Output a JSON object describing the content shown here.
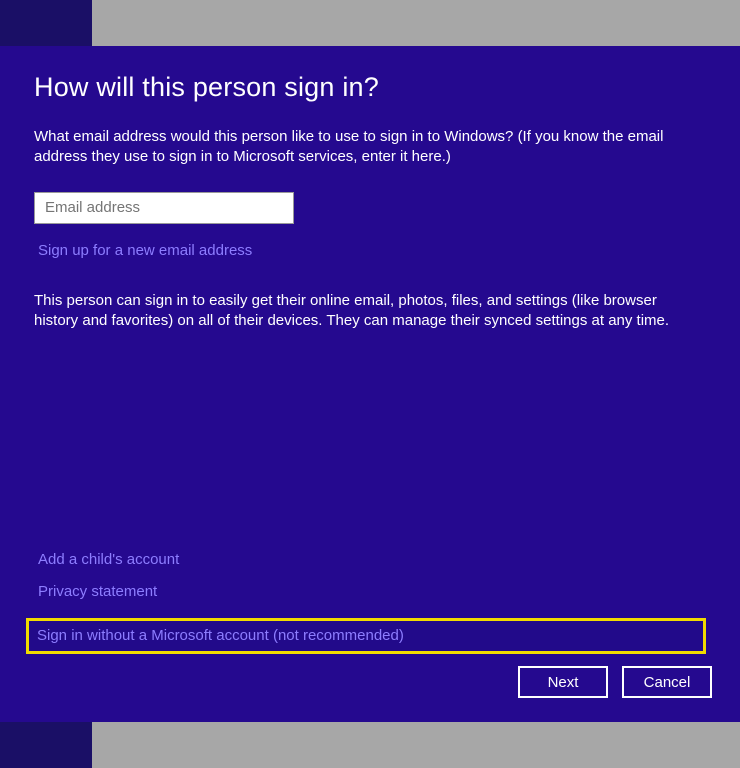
{
  "title": "How will this person sign in?",
  "intro": "What email address would this person like to use to sign in to Windows? (If you know the email address they use to sign in to Microsoft services, enter it here.)",
  "email_placeholder": "Email address",
  "signup_link": "Sign up for a new email address",
  "benefits": "This person can sign in to easily get their online email, photos, files, and settings (like browser history and favorites) on all of their devices. They can manage their synced settings at any time.",
  "links": {
    "child": "Add a child's account",
    "privacy": "Privacy statement",
    "no_account": "Sign in without a Microsoft account (not recommended)"
  },
  "buttons": {
    "next": "Next",
    "cancel": "Cancel"
  }
}
